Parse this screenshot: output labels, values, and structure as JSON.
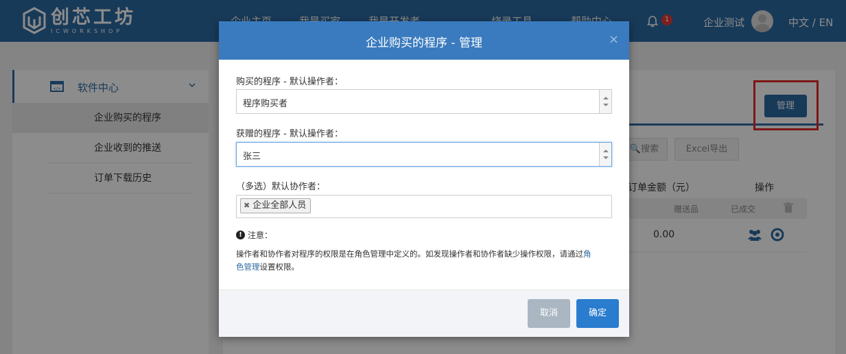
{
  "header": {
    "logo_cn": "创芯工坊",
    "logo_en": "ICWORKSHOP",
    "nav": [
      "企业主页",
      "我是买家",
      "我是开发者",
      "烧录工具",
      "帮助中心"
    ],
    "notification_count": "1",
    "user_name": "企业测试",
    "language": "中文 / EN"
  },
  "sidebar": {
    "title": "软件中心",
    "items": [
      {
        "label": "企业购买的程序"
      },
      {
        "label": "企业收到的推送"
      },
      {
        "label": "订单下载历史"
      }
    ]
  },
  "main": {
    "manage_button": "管理",
    "search_button": "搜索",
    "excel_button": "Excel导出",
    "columns": {
      "amount": "订单金额（元）",
      "action": "操作"
    },
    "subcolumns": {
      "gift": "赠送品",
      "done": "已成交"
    },
    "row": {
      "amount": "0.00"
    }
  },
  "modal": {
    "title": "企业购买的程序 - 管理",
    "purchased_label": "购买的程序 - 默认操作者：",
    "purchased_value": "程序购买者",
    "gifted_label": "获赠的程序 - 默认操作者：",
    "gifted_value": "张三",
    "collab_label": "（多选）默认协作者：",
    "collab_tag": "企业全部人员",
    "note_title": "注意：",
    "note_text_1": "操作者和协作者对程序的权限是在角色管理中定义的。如发现操作者和协作者缺少操作权限，请通过",
    "note_link_1": "角",
    "note_link_2": "色管理",
    "note_text_2": "设置权限。",
    "cancel": "取消",
    "confirm": "确定"
  },
  "colors": {
    "brand": "#2c6ba3",
    "modal_header": "#3a7bbf",
    "confirm": "#2a7ccf",
    "cancel": "#aab6c1",
    "highlight": "#e22a2a"
  }
}
